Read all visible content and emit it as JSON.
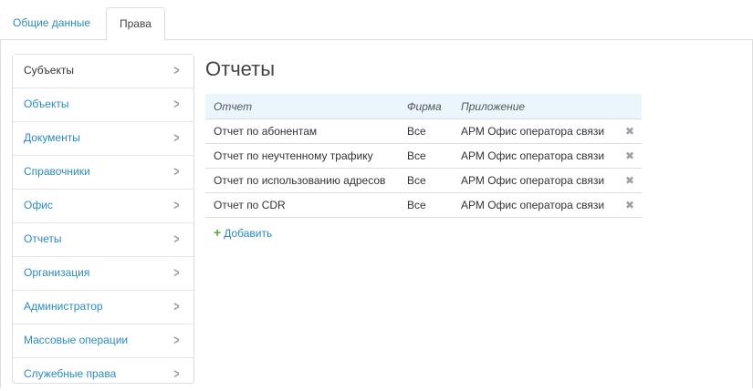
{
  "tabs": [
    {
      "label": "Общие данные"
    },
    {
      "label": "Права"
    }
  ],
  "sidebar": {
    "items": [
      {
        "label": "Субъекты"
      },
      {
        "label": "Объекты"
      },
      {
        "label": "Документы"
      },
      {
        "label": "Справочники"
      },
      {
        "label": "Офис"
      },
      {
        "label": "Отчеты"
      },
      {
        "label": "Организация"
      },
      {
        "label": "Администратор"
      },
      {
        "label": "Массовые операции"
      },
      {
        "label": "Служебные права"
      }
    ]
  },
  "main": {
    "title": "Отчеты",
    "columns": {
      "report": "Отчет",
      "firm": "Фирма",
      "app": "Приложение"
    },
    "rows": [
      {
        "report": "Отчет по абонентам",
        "firm": "Все",
        "app": "АРМ Офис оператора связи"
      },
      {
        "report": "Отчет по неучтенному трафику",
        "firm": "Все",
        "app": "АРМ Офис оператора связи"
      },
      {
        "report": "Отчет по использованию адресов",
        "firm": "Все",
        "app": "АРМ Офис оператора связи"
      },
      {
        "report": "Отчет по CDR",
        "firm": "Все",
        "app": "АРМ Офис оператора связи"
      }
    ],
    "add_label": "Добавить"
  },
  "colors": {
    "link": "#2a8bc5",
    "add_icon": "#5aa73c",
    "header_bg": "#eaf6fb"
  }
}
